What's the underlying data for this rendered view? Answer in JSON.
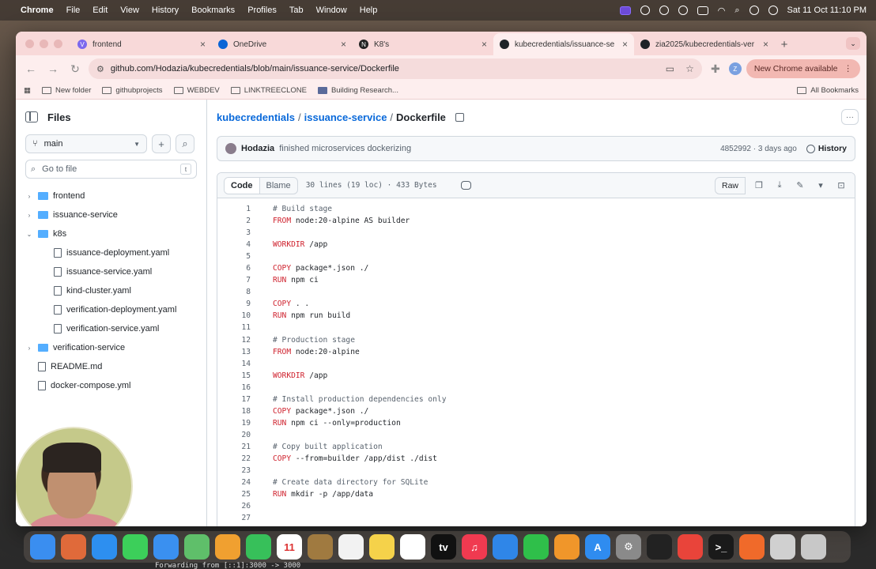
{
  "menubar": {
    "app": "Chrome",
    "items": [
      "File",
      "Edit",
      "View",
      "History",
      "Bookmarks",
      "Profiles",
      "Tab",
      "Window",
      "Help"
    ],
    "clock": "Sat 11 Oct  11:10 PM"
  },
  "tabs": [
    {
      "label": "frontend",
      "favicon_color": "#7b68ee",
      "glyph": "V"
    },
    {
      "label": "OneDrive",
      "favicon_color": "#0a64d6",
      "glyph": ""
    },
    {
      "label": "K8's",
      "favicon_color": "#222222",
      "glyph": "N"
    },
    {
      "label": "kubecredentials/issuance-se",
      "favicon_color": "#1f2328",
      "glyph": ""
    },
    {
      "label": "zia2025/kubecredentials-ver",
      "favicon_color": "#1f2328",
      "glyph": ""
    }
  ],
  "address_bar": {
    "url": "github.com/Hodazia/kubecredentials/blob/main/issuance-service/Dockerfile",
    "profile_badge": "Z",
    "update_label": "New Chrome available"
  },
  "bookmarks": {
    "items": [
      "New folder",
      "githubprojects",
      "WEBDEV",
      "LINKTREECLONE",
      "Building Research..."
    ],
    "all_label": "All Bookmarks"
  },
  "sidebar": {
    "title": "Files",
    "branch": "main",
    "goto_placeholder": "Go to file",
    "goto_shortcut": "t",
    "tree": [
      {
        "label": "frontend",
        "type": "dir",
        "depth": 0,
        "chev": "›"
      },
      {
        "label": "issuance-service",
        "type": "dir",
        "depth": 0,
        "chev": "›"
      },
      {
        "label": "k8s",
        "type": "dir",
        "depth": 0,
        "chev": "⌄"
      },
      {
        "label": "issuance-deployment.yaml",
        "type": "file",
        "depth": 1,
        "chev": ""
      },
      {
        "label": "issuance-service.yaml",
        "type": "file",
        "depth": 1,
        "chev": ""
      },
      {
        "label": "kind-cluster.yaml",
        "type": "file",
        "depth": 1,
        "chev": ""
      },
      {
        "label": "verification-deployment.yaml",
        "type": "file",
        "depth": 1,
        "chev": ""
      },
      {
        "label": "verification-service.yaml",
        "type": "file",
        "depth": 1,
        "chev": ""
      },
      {
        "label": "verification-service",
        "type": "dir",
        "depth": 0,
        "chev": "›"
      },
      {
        "label": "README.md",
        "type": "file",
        "depth": 0,
        "chev": ""
      },
      {
        "label": "docker-compose.yml",
        "type": "file",
        "depth": 0,
        "chev": ""
      }
    ]
  },
  "breadcrumb": {
    "repo": "kubecredentials",
    "folder": "issuance-service",
    "file": "Dockerfile"
  },
  "commit": {
    "author": "Hodazia",
    "message": "finished microservices dockerizing",
    "meta": "4852992 · 3 days ago",
    "history_label": "History"
  },
  "file_header": {
    "code_tab": "Code",
    "blame_tab": "Blame",
    "stats": "30 lines (19 loc) · 433 Bytes",
    "raw_label": "Raw"
  },
  "code_lines": [
    {
      "n": "1",
      "kw": "",
      "text": "# Build stage",
      "comment": true
    },
    {
      "n": "2",
      "kw": "FROM",
      "text": " node:20-alpine AS builder",
      "comment": false
    },
    {
      "n": "3",
      "kw": "",
      "text": "",
      "comment": false
    },
    {
      "n": "4",
      "kw": "WORKDIR",
      "text": " /app",
      "comment": false
    },
    {
      "n": "5",
      "kw": "",
      "text": "",
      "comment": false
    },
    {
      "n": "6",
      "kw": "COPY",
      "text": " package*.json ./",
      "comment": false
    },
    {
      "n": "7",
      "kw": "RUN",
      "text": " npm ci",
      "comment": false
    },
    {
      "n": "8",
      "kw": "",
      "text": "",
      "comment": false
    },
    {
      "n": "9",
      "kw": "COPY",
      "text": " . .",
      "comment": false
    },
    {
      "n": "10",
      "kw": "RUN",
      "text": " npm run build",
      "comment": false
    },
    {
      "n": "11",
      "kw": "",
      "text": "",
      "comment": false
    },
    {
      "n": "12",
      "kw": "",
      "text": "# Production stage",
      "comment": true
    },
    {
      "n": "13",
      "kw": "FROM",
      "text": " node:20-alpine",
      "comment": false
    },
    {
      "n": "14",
      "kw": "",
      "text": "",
      "comment": false
    },
    {
      "n": "15",
      "kw": "WORKDIR",
      "text": " /app",
      "comment": false
    },
    {
      "n": "16",
      "kw": "",
      "text": "",
      "comment": false
    },
    {
      "n": "17",
      "kw": "",
      "text": "# Install production dependencies only",
      "comment": true
    },
    {
      "n": "18",
      "kw": "COPY",
      "text": " package*.json ./",
      "comment": false
    },
    {
      "n": "19",
      "kw": "RUN",
      "text": " npm ci --only=production",
      "comment": false
    },
    {
      "n": "20",
      "kw": "",
      "text": "",
      "comment": false
    },
    {
      "n": "21",
      "kw": "",
      "text": "# Copy built application",
      "comment": true
    },
    {
      "n": "22",
      "kw": "COPY",
      "text": " --from=builder /app/dist ./dist",
      "comment": false
    },
    {
      "n": "23",
      "kw": "",
      "text": "",
      "comment": false
    },
    {
      "n": "24",
      "kw": "",
      "text": "# Create data directory for SQLite",
      "comment": true
    },
    {
      "n": "25",
      "kw": "RUN",
      "text": " mkdir -p /app/data",
      "comment": false
    },
    {
      "n": "26",
      "kw": "",
      "text": "",
      "comment": false
    },
    {
      "n": "27",
      "kw": "",
      "text": "",
      "comment": false
    }
  ],
  "dock": {
    "apps": [
      {
        "name": "finder-icon",
        "color": "#3a8ef0",
        "glyph": ""
      },
      {
        "name": "launchpad-icon",
        "color": "#e06a3a",
        "glyph": ""
      },
      {
        "name": "safari-icon",
        "color": "#2d8ff0",
        "glyph": ""
      },
      {
        "name": "messages-icon",
        "color": "#3ccf5a",
        "glyph": ""
      },
      {
        "name": "mail-icon",
        "color": "#3a90f0",
        "glyph": ""
      },
      {
        "name": "maps-icon",
        "color": "#5fbf6a",
        "glyph": ""
      },
      {
        "name": "photos-icon",
        "color": "#f0a030",
        "glyph": ""
      },
      {
        "name": "facetime-icon",
        "color": "#37c05a",
        "glyph": ""
      },
      {
        "name": "calendar-icon",
        "color": "#ffffff",
        "glyph": "11"
      },
      {
        "name": "brown-app-icon",
        "color": "#a07a40",
        "glyph": ""
      },
      {
        "name": "reminders-icon",
        "color": "#f2f2f2",
        "glyph": ""
      },
      {
        "name": "notes-icon",
        "color": "#f5d24a",
        "glyph": ""
      },
      {
        "name": "freeform-icon",
        "color": "#ffffff",
        "glyph": ""
      },
      {
        "name": "appletv-icon",
        "color": "#111111",
        "glyph": "tv"
      },
      {
        "name": "music-icon",
        "color": "#f03a50",
        "glyph": "♫"
      },
      {
        "name": "keynote-icon",
        "color": "#2f86e8",
        "glyph": ""
      },
      {
        "name": "numbers-icon",
        "color": "#2fbf4a",
        "glyph": ""
      },
      {
        "name": "pages-icon",
        "color": "#f0962a",
        "glyph": ""
      },
      {
        "name": "appstore-icon",
        "color": "#2f8cf0",
        "glyph": "A"
      },
      {
        "name": "settings-icon",
        "color": "#8a8a8a",
        "glyph": "⚙"
      },
      {
        "name": "cursor-icon",
        "color": "#222222",
        "glyph": ""
      },
      {
        "name": "chrome-icon",
        "color": "#e9443a",
        "glyph": ""
      },
      {
        "name": "terminal-icon",
        "color": "#1a1a1a",
        "glyph": ">_"
      },
      {
        "name": "postman-icon",
        "color": "#f06a2a",
        "glyph": ""
      },
      {
        "name": "preview-icon",
        "color": "#d0d0d0",
        "glyph": ""
      },
      {
        "name": "trash-icon",
        "color": "#c8c8c8",
        "glyph": ""
      }
    ]
  },
  "terminal_line": "Forwarding from [::1]:3000 -> 3000"
}
